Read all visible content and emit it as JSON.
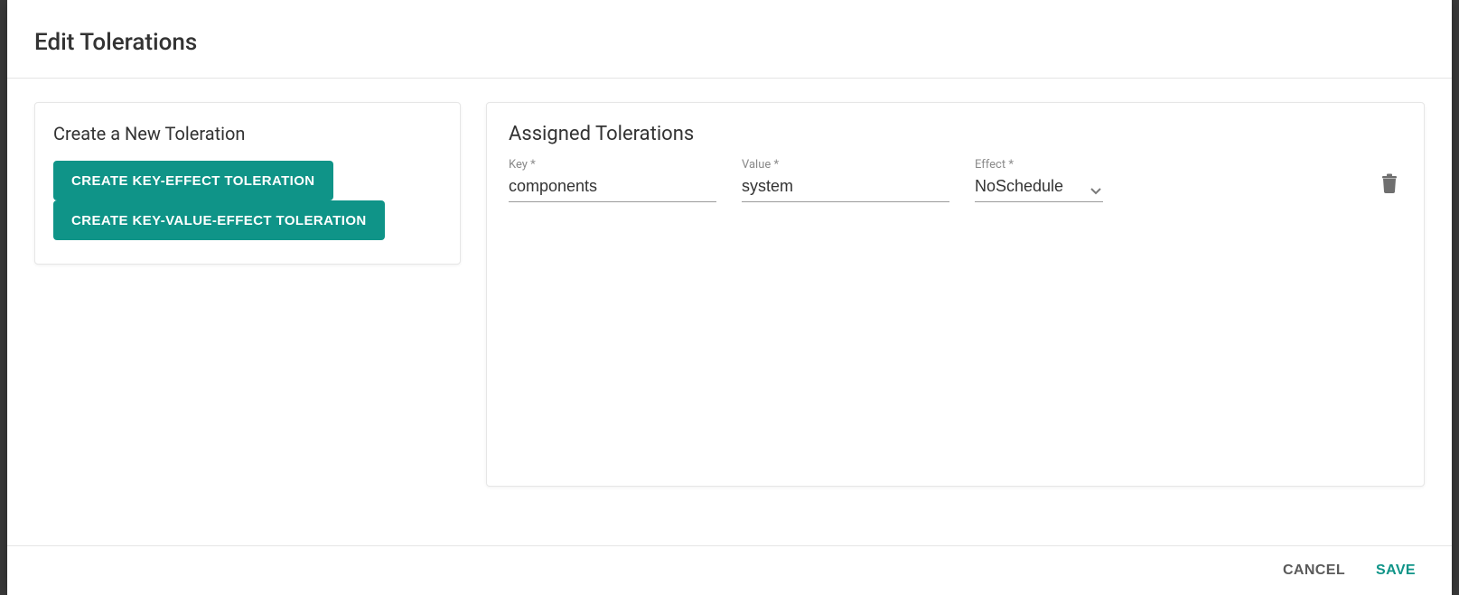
{
  "header": {
    "title": "Edit Tolerations"
  },
  "create": {
    "title": "Create a New Toleration",
    "key_effect_btn": "CREATE KEY-EFFECT TOLERATION",
    "key_value_effect_btn": "CREATE KEY-VALUE-EFFECT TOLERATION"
  },
  "assigned": {
    "title": "Assigned Tolerations",
    "rows": [
      {
        "key_label": "Key *",
        "key_value": "components",
        "value_label": "Value *",
        "value_value": "system",
        "effect_label": "Effect *",
        "effect_value": "NoSchedule"
      }
    ]
  },
  "footer": {
    "cancel": "CANCEL",
    "save": "SAVE"
  },
  "icons": {
    "chevron_down": "chevron-down-icon",
    "trash": "trash-icon"
  },
  "colors": {
    "accent": "#0f9488"
  }
}
